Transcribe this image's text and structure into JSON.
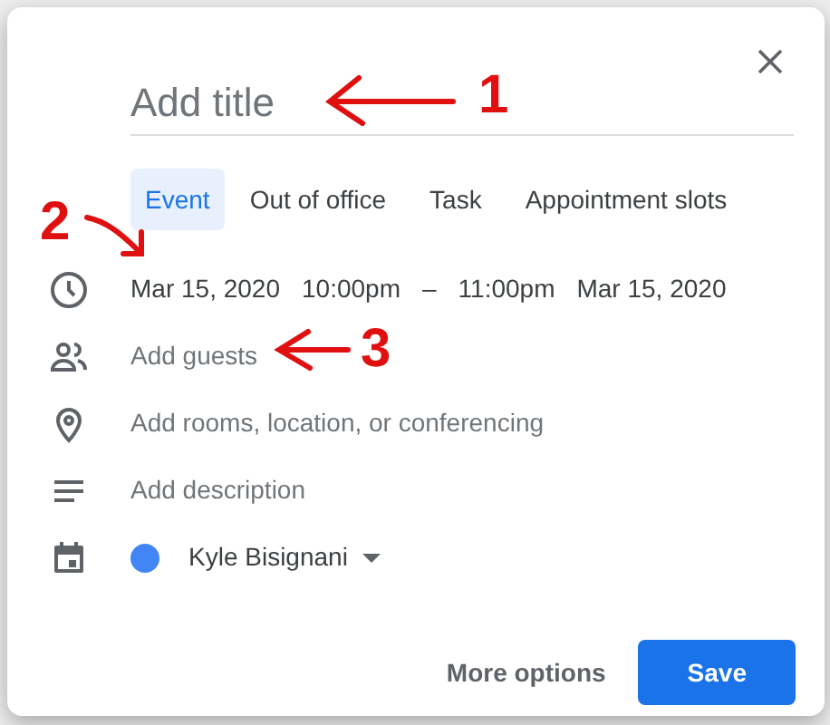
{
  "dialog": {
    "title_placeholder": "Add title",
    "tabs": [
      {
        "label": "Event",
        "selected": true
      },
      {
        "label": "Out of office",
        "selected": false
      },
      {
        "label": "Task",
        "selected": false
      },
      {
        "label": "Appointment slots",
        "selected": false
      }
    ],
    "rows": [
      {
        "kind": "datetime",
        "parts": [
          "Mar 15, 2020",
          "10:00pm",
          "–",
          "11:00pm",
          "Mar 15, 2020"
        ]
      },
      {
        "kind": "guests",
        "text": "Add guests"
      },
      {
        "kind": "location",
        "text": "Add rooms, location, or conferencing"
      },
      {
        "kind": "description",
        "text": "Add description"
      },
      {
        "kind": "calendar",
        "text": "Kyle Bisignani",
        "color": "#4285f4"
      }
    ],
    "buttons": [
      {
        "label": "More options",
        "kind": "text"
      },
      {
        "label": "Save",
        "kind": "primary"
      }
    ]
  },
  "annotations": [
    {
      "label": "1"
    },
    {
      "label": "2"
    },
    {
      "label": "3"
    }
  ]
}
